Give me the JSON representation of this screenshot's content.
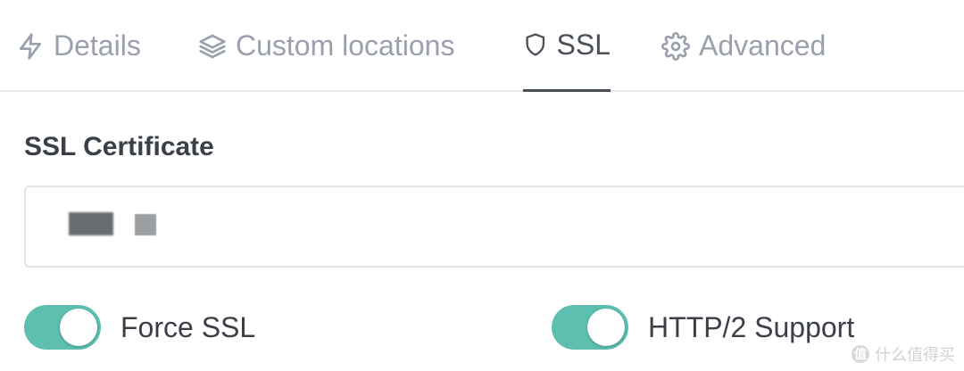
{
  "tabs": [
    {
      "label": "Details",
      "icon": "lightning-icon",
      "active": false
    },
    {
      "label": "Custom locations",
      "icon": "layers-icon",
      "active": false
    },
    {
      "label": "SSL",
      "icon": "shield-icon",
      "active": true
    },
    {
      "label": "Advanced",
      "icon": "gear-icon",
      "active": false
    }
  ],
  "ssl": {
    "certificate_label": "SSL Certificate"
  },
  "toggles": {
    "force_ssl": {
      "label": "Force SSL",
      "enabled": true
    },
    "http2": {
      "label": "HTTP/2 Support",
      "enabled": true
    }
  },
  "colors": {
    "toggle_on": "#5cbfaf",
    "active_tab": "#495057",
    "inactive_tab": "#9aa0ac"
  },
  "watermark": {
    "text": "什么值得买",
    "mark": "值"
  }
}
